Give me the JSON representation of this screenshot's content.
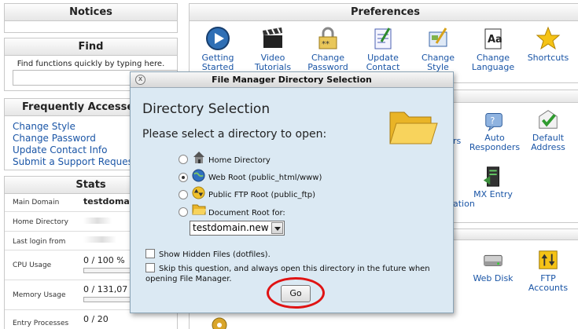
{
  "notices": {
    "title": "Notices"
  },
  "find": {
    "title": "Find",
    "hint": "Find functions quickly by typing here."
  },
  "frequently_accessed": {
    "title": "Frequently Accessed",
    "links": [
      "Change Style",
      "Change Password",
      "Update Contact Info",
      "Submit a Support Request"
    ]
  },
  "stats": {
    "title": "Stats",
    "rows": [
      {
        "label": "Main Domain",
        "value": "testdomai"
      },
      {
        "label": "Home Directory",
        "value": ""
      },
      {
        "label": "Last login from",
        "value": ""
      },
      {
        "label": "CPU Usage",
        "value": "0 / 100 %"
      },
      {
        "label": "Memory Usage",
        "value": "0 / 131,07"
      },
      {
        "label": "Entry Processes",
        "value": "0 / 20"
      }
    ]
  },
  "preferences": {
    "title": "Preferences",
    "items": [
      {
        "label1": "Getting",
        "label2": "Started",
        "icon": "play-icon"
      },
      {
        "label1": "Video",
        "label2": "Tutorials",
        "icon": "film-clapper-icon"
      },
      {
        "label1": "Change",
        "label2": "Password",
        "icon": "padlock-icon"
      },
      {
        "label1": "Update",
        "label2": "Contact",
        "icon": "contact-info-icon"
      },
      {
        "label1": "Change",
        "label2": "Style",
        "icon": "style-icon"
      },
      {
        "label1": "Change",
        "label2": "Language",
        "icon": "language-icon"
      },
      {
        "label1": "Shortcuts",
        "label2": "",
        "icon": "star-icon"
      }
    ]
  },
  "mail": {
    "items": [
      {
        "label1": "Auto",
        "label2": "Responders",
        "icon": "auto-responder-icon"
      },
      {
        "label1": "Default",
        "label2": "Address",
        "icon": "default-address-icon"
      },
      {
        "label1": "MX Entry",
        "label2": "",
        "icon": "mx-entry-icon"
      }
    ],
    "partial_1": "rs",
    "partial_2": "ation"
  },
  "files": {
    "items": [
      {
        "label1": "Web Disk",
        "label2": "",
        "icon": "web-disk-icon"
      },
      {
        "label1": "FTP",
        "label2": "Accounts",
        "icon": "ftp-accounts-icon"
      }
    ]
  },
  "dialog": {
    "title": "File Manager Directory Selection",
    "heading": "Directory Selection",
    "prompt": "Please select a directory to open:",
    "options": [
      {
        "label": "Home Directory",
        "icon": "house-icon",
        "selected": false
      },
      {
        "label": "Web Root (public_html/www)",
        "icon": "globe-icon",
        "selected": true
      },
      {
        "label": "Public FTP Root (public_ftp)",
        "icon": "ftp-root-icon",
        "selected": false
      },
      {
        "label": "Document Root for:",
        "icon": "folder-icon",
        "selected": false
      }
    ],
    "domain_select": "testdomain.new",
    "show_hidden": "Show Hidden Files (dotfiles).",
    "skip_line1": "Skip this question, and always open this directory in the future when",
    "skip_line2": "opening File Manager.",
    "go_label": "Go",
    "highlight_color": "#e01313"
  }
}
